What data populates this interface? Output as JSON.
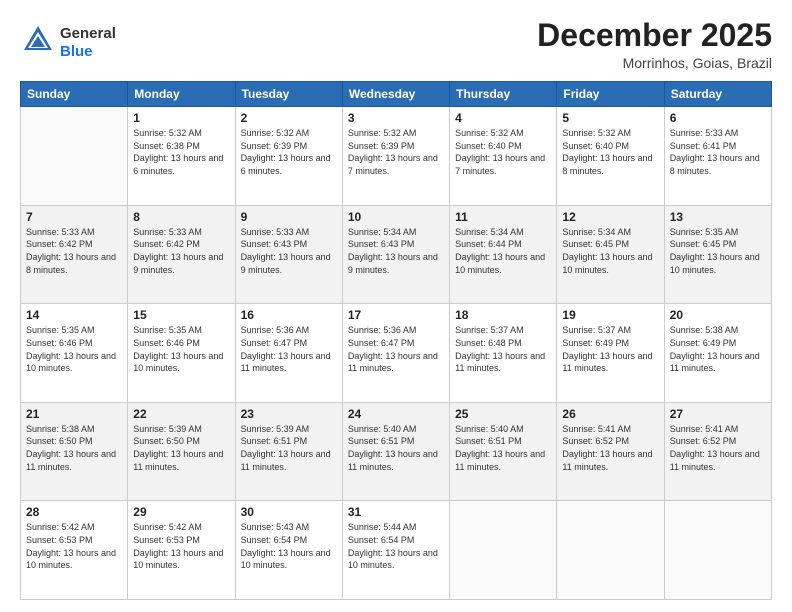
{
  "header": {
    "logo_general": "General",
    "logo_blue": "Blue",
    "month_title": "December 2025",
    "location": "Morrinhos, Goias, Brazil"
  },
  "days_of_week": [
    "Sunday",
    "Monday",
    "Tuesday",
    "Wednesday",
    "Thursday",
    "Friday",
    "Saturday"
  ],
  "weeks": [
    [
      {
        "day": "",
        "sunrise": "",
        "sunset": "",
        "daylight": ""
      },
      {
        "day": "1",
        "sunrise": "Sunrise: 5:32 AM",
        "sunset": "Sunset: 6:38 PM",
        "daylight": "Daylight: 13 hours and 6 minutes."
      },
      {
        "day": "2",
        "sunrise": "Sunrise: 5:32 AM",
        "sunset": "Sunset: 6:39 PM",
        "daylight": "Daylight: 13 hours and 6 minutes."
      },
      {
        "day": "3",
        "sunrise": "Sunrise: 5:32 AM",
        "sunset": "Sunset: 6:39 PM",
        "daylight": "Daylight: 13 hours and 7 minutes."
      },
      {
        "day": "4",
        "sunrise": "Sunrise: 5:32 AM",
        "sunset": "Sunset: 6:40 PM",
        "daylight": "Daylight: 13 hours and 7 minutes."
      },
      {
        "day": "5",
        "sunrise": "Sunrise: 5:32 AM",
        "sunset": "Sunset: 6:40 PM",
        "daylight": "Daylight: 13 hours and 8 minutes."
      },
      {
        "day": "6",
        "sunrise": "Sunrise: 5:33 AM",
        "sunset": "Sunset: 6:41 PM",
        "daylight": "Daylight: 13 hours and 8 minutes."
      }
    ],
    [
      {
        "day": "7",
        "sunrise": "Sunrise: 5:33 AM",
        "sunset": "Sunset: 6:42 PM",
        "daylight": "Daylight: 13 hours and 8 minutes."
      },
      {
        "day": "8",
        "sunrise": "Sunrise: 5:33 AM",
        "sunset": "Sunset: 6:42 PM",
        "daylight": "Daylight: 13 hours and 9 minutes."
      },
      {
        "day": "9",
        "sunrise": "Sunrise: 5:33 AM",
        "sunset": "Sunset: 6:43 PM",
        "daylight": "Daylight: 13 hours and 9 minutes."
      },
      {
        "day": "10",
        "sunrise": "Sunrise: 5:34 AM",
        "sunset": "Sunset: 6:43 PM",
        "daylight": "Daylight: 13 hours and 9 minutes."
      },
      {
        "day": "11",
        "sunrise": "Sunrise: 5:34 AM",
        "sunset": "Sunset: 6:44 PM",
        "daylight": "Daylight: 13 hours and 10 minutes."
      },
      {
        "day": "12",
        "sunrise": "Sunrise: 5:34 AM",
        "sunset": "Sunset: 6:45 PM",
        "daylight": "Daylight: 13 hours and 10 minutes."
      },
      {
        "day": "13",
        "sunrise": "Sunrise: 5:35 AM",
        "sunset": "Sunset: 6:45 PM",
        "daylight": "Daylight: 13 hours and 10 minutes."
      }
    ],
    [
      {
        "day": "14",
        "sunrise": "Sunrise: 5:35 AM",
        "sunset": "Sunset: 6:46 PM",
        "daylight": "Daylight: 13 hours and 10 minutes."
      },
      {
        "day": "15",
        "sunrise": "Sunrise: 5:35 AM",
        "sunset": "Sunset: 6:46 PM",
        "daylight": "Daylight: 13 hours and 10 minutes."
      },
      {
        "day": "16",
        "sunrise": "Sunrise: 5:36 AM",
        "sunset": "Sunset: 6:47 PM",
        "daylight": "Daylight: 13 hours and 11 minutes."
      },
      {
        "day": "17",
        "sunrise": "Sunrise: 5:36 AM",
        "sunset": "Sunset: 6:47 PM",
        "daylight": "Daylight: 13 hours and 11 minutes."
      },
      {
        "day": "18",
        "sunrise": "Sunrise: 5:37 AM",
        "sunset": "Sunset: 6:48 PM",
        "daylight": "Daylight: 13 hours and 11 minutes."
      },
      {
        "day": "19",
        "sunrise": "Sunrise: 5:37 AM",
        "sunset": "Sunset: 6:49 PM",
        "daylight": "Daylight: 13 hours and 11 minutes."
      },
      {
        "day": "20",
        "sunrise": "Sunrise: 5:38 AM",
        "sunset": "Sunset: 6:49 PM",
        "daylight": "Daylight: 13 hours and 11 minutes."
      }
    ],
    [
      {
        "day": "21",
        "sunrise": "Sunrise: 5:38 AM",
        "sunset": "Sunset: 6:50 PM",
        "daylight": "Daylight: 13 hours and 11 minutes."
      },
      {
        "day": "22",
        "sunrise": "Sunrise: 5:39 AM",
        "sunset": "Sunset: 6:50 PM",
        "daylight": "Daylight: 13 hours and 11 minutes."
      },
      {
        "day": "23",
        "sunrise": "Sunrise: 5:39 AM",
        "sunset": "Sunset: 6:51 PM",
        "daylight": "Daylight: 13 hours and 11 minutes."
      },
      {
        "day": "24",
        "sunrise": "Sunrise: 5:40 AM",
        "sunset": "Sunset: 6:51 PM",
        "daylight": "Daylight: 13 hours and 11 minutes."
      },
      {
        "day": "25",
        "sunrise": "Sunrise: 5:40 AM",
        "sunset": "Sunset: 6:51 PM",
        "daylight": "Daylight: 13 hours and 11 minutes."
      },
      {
        "day": "26",
        "sunrise": "Sunrise: 5:41 AM",
        "sunset": "Sunset: 6:52 PM",
        "daylight": "Daylight: 13 hours and 11 minutes."
      },
      {
        "day": "27",
        "sunrise": "Sunrise: 5:41 AM",
        "sunset": "Sunset: 6:52 PM",
        "daylight": "Daylight: 13 hours and 11 minutes."
      }
    ],
    [
      {
        "day": "28",
        "sunrise": "Sunrise: 5:42 AM",
        "sunset": "Sunset: 6:53 PM",
        "daylight": "Daylight: 13 hours and 10 minutes."
      },
      {
        "day": "29",
        "sunrise": "Sunrise: 5:42 AM",
        "sunset": "Sunset: 6:53 PM",
        "daylight": "Daylight: 13 hours and 10 minutes."
      },
      {
        "day": "30",
        "sunrise": "Sunrise: 5:43 AM",
        "sunset": "Sunset: 6:54 PM",
        "daylight": "Daylight: 13 hours and 10 minutes."
      },
      {
        "day": "31",
        "sunrise": "Sunrise: 5:44 AM",
        "sunset": "Sunset: 6:54 PM",
        "daylight": "Daylight: 13 hours and 10 minutes."
      },
      {
        "day": "",
        "sunrise": "",
        "sunset": "",
        "daylight": ""
      },
      {
        "day": "",
        "sunrise": "",
        "sunset": "",
        "daylight": ""
      },
      {
        "day": "",
        "sunrise": "",
        "sunset": "",
        "daylight": ""
      }
    ]
  ]
}
